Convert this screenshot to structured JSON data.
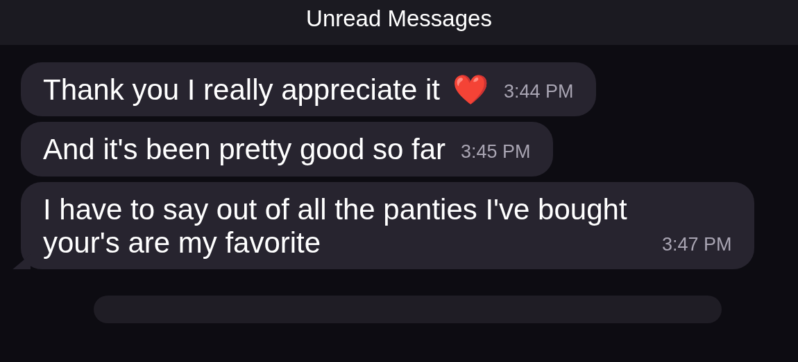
{
  "header": {
    "title": "Unread Messages"
  },
  "messages": [
    {
      "text": "Thank you I really appreciate it",
      "emoji": "❤️",
      "time": "3:44 PM",
      "tail": false
    },
    {
      "text": "And it's been pretty good so far",
      "time": "3:45 PM",
      "tail": false
    },
    {
      "text": "I have to say out of all the panties I've bought your's are my favorite",
      "time": "3:47 PM",
      "tail": true
    }
  ]
}
